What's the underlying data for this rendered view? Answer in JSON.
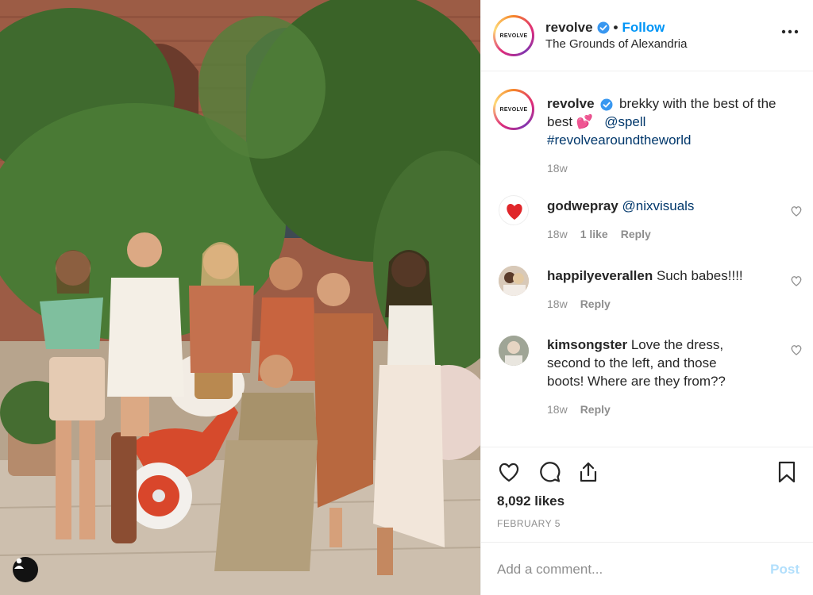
{
  "post": {
    "username": "revolve",
    "brand_logo_text": "REVOLVE",
    "follow_label": "Follow",
    "separator": "•",
    "location": "The Grounds of Alexandria",
    "more_icon": "more-horizontal-icon"
  },
  "caption": {
    "username": "revolve",
    "text_1": "brekky with the best of the",
    "text_2": "best",
    "emoji": "💕",
    "mention": "@spell",
    "hashtag": "#revolvearoundtheworld",
    "time": "18w"
  },
  "comments": [
    {
      "username": "godwepray",
      "text": "@nixvisuals",
      "time": "18w",
      "likes": "1 like",
      "reply": "Reply"
    },
    {
      "username": "happilyeverallen",
      "text": "Such babes!!!!",
      "time": "18w",
      "reply": "Reply"
    },
    {
      "username": "kimsongster",
      "text_1": "Love the dress,",
      "text_2": "second to the left, and those",
      "text_3": "boots! Where are they from??",
      "time": "18w",
      "reply": "Reply"
    }
  ],
  "actions": {
    "like_icon": "heart-icon",
    "comment_icon": "comment-icon",
    "share_icon": "share-icon",
    "save_icon": "bookmark-icon",
    "likes": "8,092 likes",
    "date": "FEBRUARY 5"
  },
  "add_comment": {
    "placeholder": "Add a comment...",
    "post_label": "Post"
  },
  "colors": {
    "link_blue": "#0095f6",
    "verified_blue": "#3897f0",
    "muted_text": "#8e8e8e",
    "border": "#efefef"
  }
}
